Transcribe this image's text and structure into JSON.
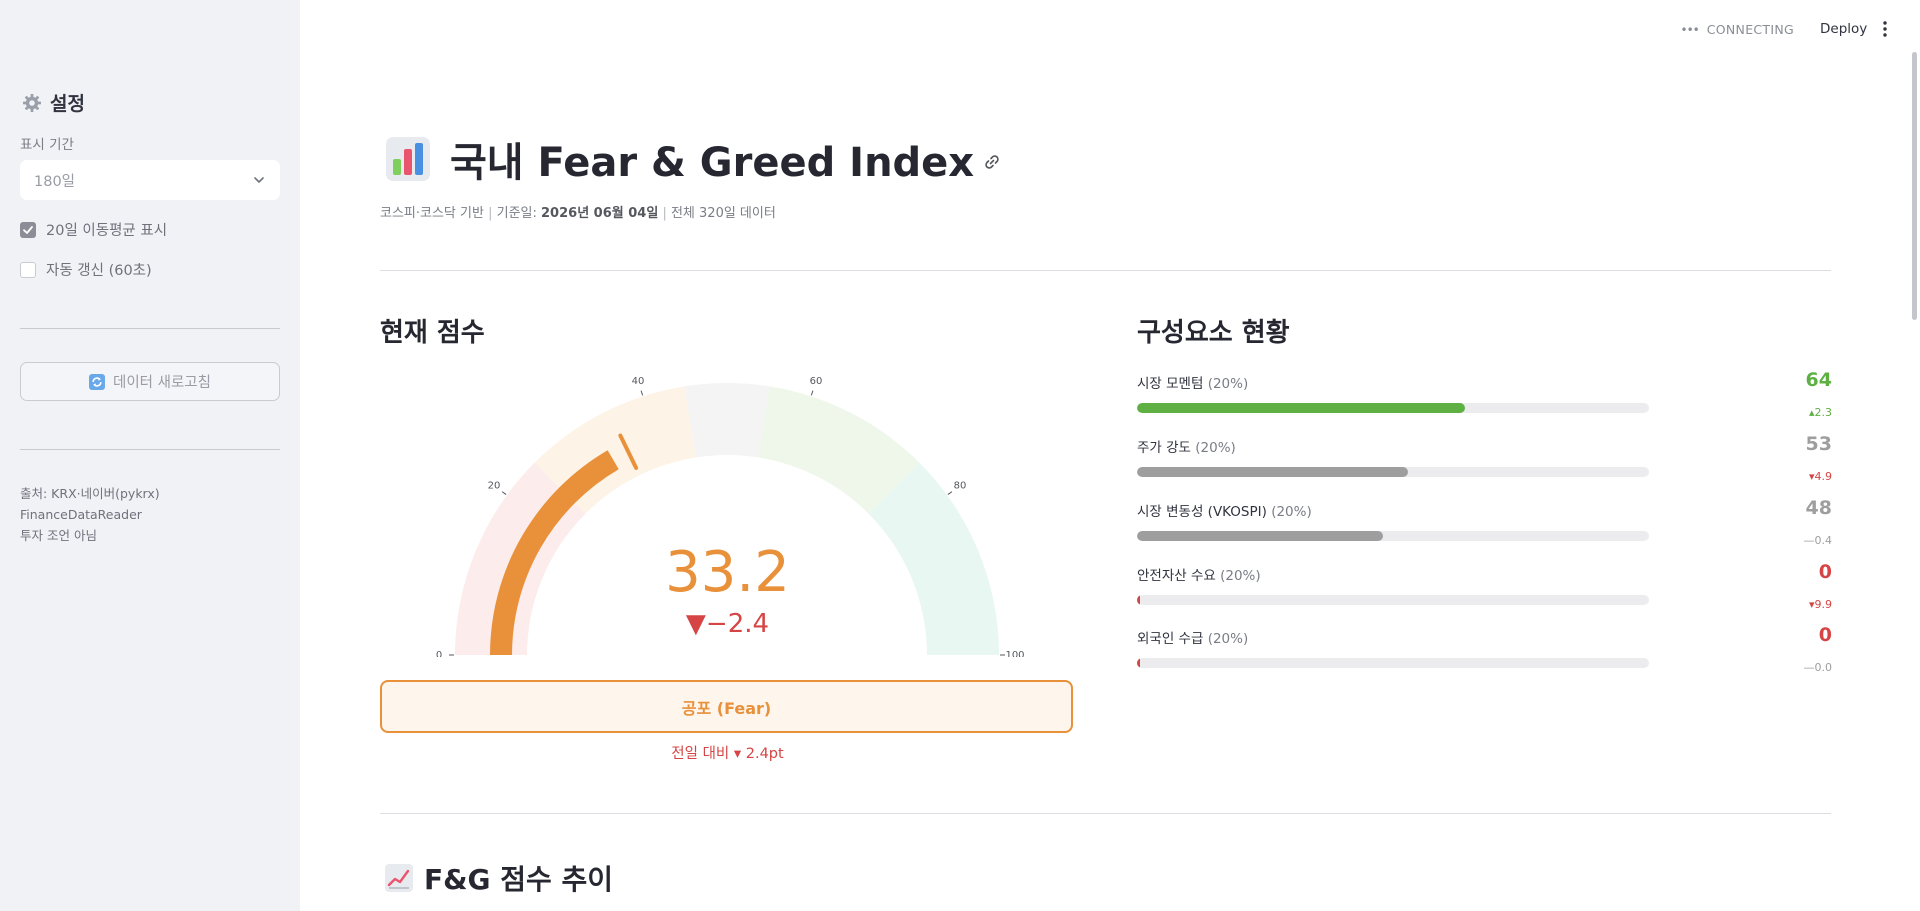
{
  "sidebar": {
    "title": "설정",
    "period_label": "표시 기간",
    "period_value": "180일",
    "ma_label": "20일 이동평균 표시",
    "ma_checked": true,
    "auto_label": "자동 갱신 (60초)",
    "auto_checked": false,
    "refresh_label": "데이터 새로고침",
    "source_line1": "출처: KRX·네이버(pykrx) FinanceDataReader",
    "source_line2": "투자 조언 아님"
  },
  "header": {
    "status": "CONNECTING",
    "deploy": "Deploy"
  },
  "main": {
    "title": "국내 Fear & Greed Index",
    "caption_prefix": "코스피·코스닥 기반",
    "caption_date_label": "기준일:",
    "caption_date": "2026년 06월 04일",
    "caption_total": "전체 320일 데이터",
    "current_title": "현재 점수",
    "score": "33.2",
    "score_value": 33.2,
    "score_delta": "▼−2.4",
    "label": "공포 (Fear)",
    "prev_compare": "전일 대비 ▾ 2.4pt",
    "gauge_ticks": [
      "0",
      "20",
      "40",
      "60",
      "80",
      "100"
    ],
    "components_title": "구성요소 현황",
    "components": [
      {
        "name": "시장 모멘텀",
        "weight": "(20%)",
        "score": "64",
        "value": 64,
        "change": "▴2.3",
        "color": "#5fb043",
        "change_color": "#5fb043"
      },
      {
        "name": "주가 강도",
        "weight": "(20%)",
        "score": "53",
        "value": 53,
        "change": "▾4.9",
        "color": "#9e9e9e",
        "change_color": "#d64545"
      },
      {
        "name": "시장 변동성 (VKOSPI)",
        "weight": "(20%)",
        "score": "48",
        "value": 48,
        "change": "—0.4",
        "color": "#9e9e9e",
        "change_color": "#9e9e9e"
      },
      {
        "name": "안전자산 수요",
        "weight": "(20%)",
        "score": "0",
        "value": 0,
        "change": "▾9.9",
        "color": "#d64545",
        "change_color": "#d64545"
      },
      {
        "name": "외국인 수급",
        "weight": "(20%)",
        "score": "0",
        "value": 0,
        "change": "—0.0",
        "color": "#d64545",
        "change_color": "#9e9e9e"
      }
    ],
    "trend_title": "F&G 점수 추이"
  },
  "colors": {
    "fear": "#e8913a",
    "down": "#d64545",
    "up": "#5fb043",
    "neutral": "#9e9e9e"
  }
}
